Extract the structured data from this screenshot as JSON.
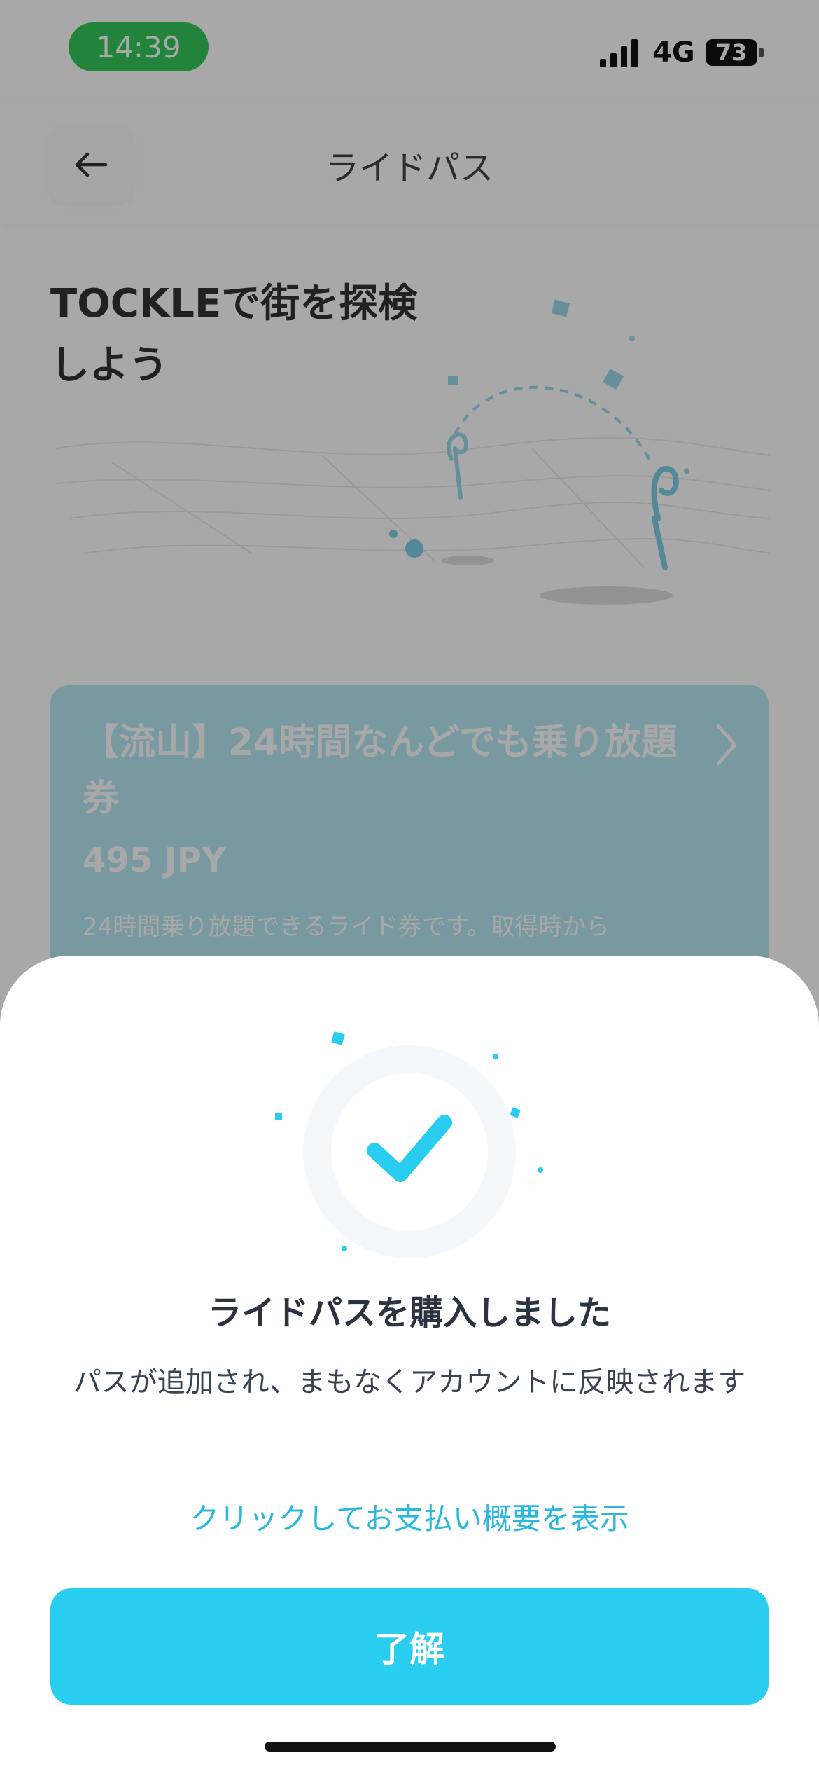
{
  "status_bar": {
    "time": "14:39",
    "network": "4G",
    "battery": "73"
  },
  "header": {
    "title": "ライドパス",
    "back_icon": "arrow-left-icon"
  },
  "hero": {
    "title": "TOCKLEで街を探検しよう"
  },
  "pass_card": {
    "name": "【流山】24時間なんどでも乗り放題券",
    "price": "495 JPY",
    "description": "24時間乗り放題できるライド券です。取得時から",
    "color": "#b5e8f2"
  },
  "dialog": {
    "title": "ライドパスを購入しました",
    "message": "パスが追加され、まもなくアカウントに反映されます",
    "link": "クリックしてお支払い概要を表示",
    "button": "了解",
    "accent_color": "#29cdef",
    "icon": "checkmark-icon"
  }
}
